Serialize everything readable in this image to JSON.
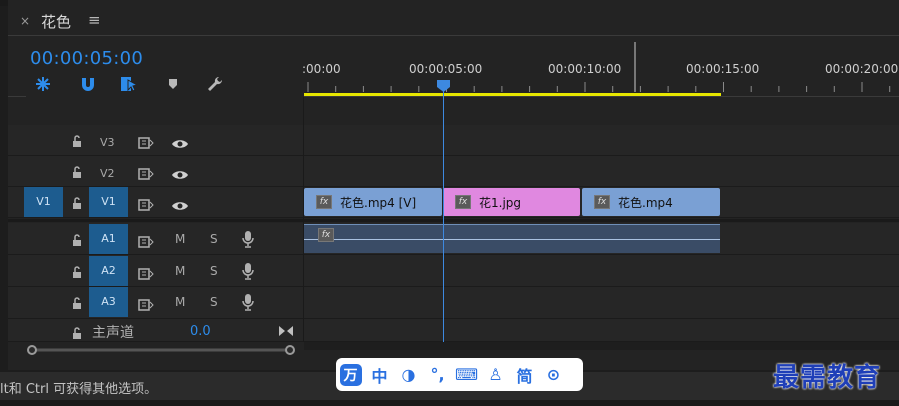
{
  "panel": {
    "close_glyph": "×",
    "title": "花色",
    "menu_glyph": "≡",
    "timecode": "00:00:05:00"
  },
  "toolbar": {
    "icons": [
      "nest-sequence-icon",
      "snap-magnet-icon",
      "linked-selection-icon",
      "add-marker-icon",
      "wrench-settings-icon"
    ]
  },
  "ruler": {
    "labels": [
      ":00:00",
      "00:00:05:00",
      "00:00:10:00",
      "00:00:15:00",
      "00:00:20:00"
    ]
  },
  "tracks": {
    "v3": {
      "name": "V3"
    },
    "v2": {
      "name": "V2"
    },
    "v1": {
      "source": "V1",
      "name": "V1"
    },
    "a1": {
      "name": "A1",
      "m": "M",
      "s": "S"
    },
    "a2": {
      "name": "A2",
      "m": "M",
      "s": "S"
    },
    "a3": {
      "name": "A3",
      "m": "M",
      "s": "S"
    },
    "master": {
      "label": "主声道",
      "value": "0.0"
    }
  },
  "clips": {
    "fx_label": "fx",
    "clip1": {
      "label": "花色.mp4 [V]",
      "color": "#7aa0d4"
    },
    "clip2": {
      "label": "花1.jpg",
      "color": "#e088e0"
    },
    "clip3": {
      "label": "花色.mp4",
      "color": "#7aa0d4"
    }
  },
  "status": {
    "text": "lt和 Ctrl 可获得其他选项。"
  },
  "ime": {
    "items": [
      "万",
      "中",
      "◑",
      "°,",
      "⌨",
      "♙",
      "简",
      "⊙"
    ]
  },
  "brand": {
    "text": "最需教育"
  },
  "colors": {
    "accent": "#2d8ceb",
    "workarea": "#e6e600",
    "track_target": "#1d5c8f"
  }
}
